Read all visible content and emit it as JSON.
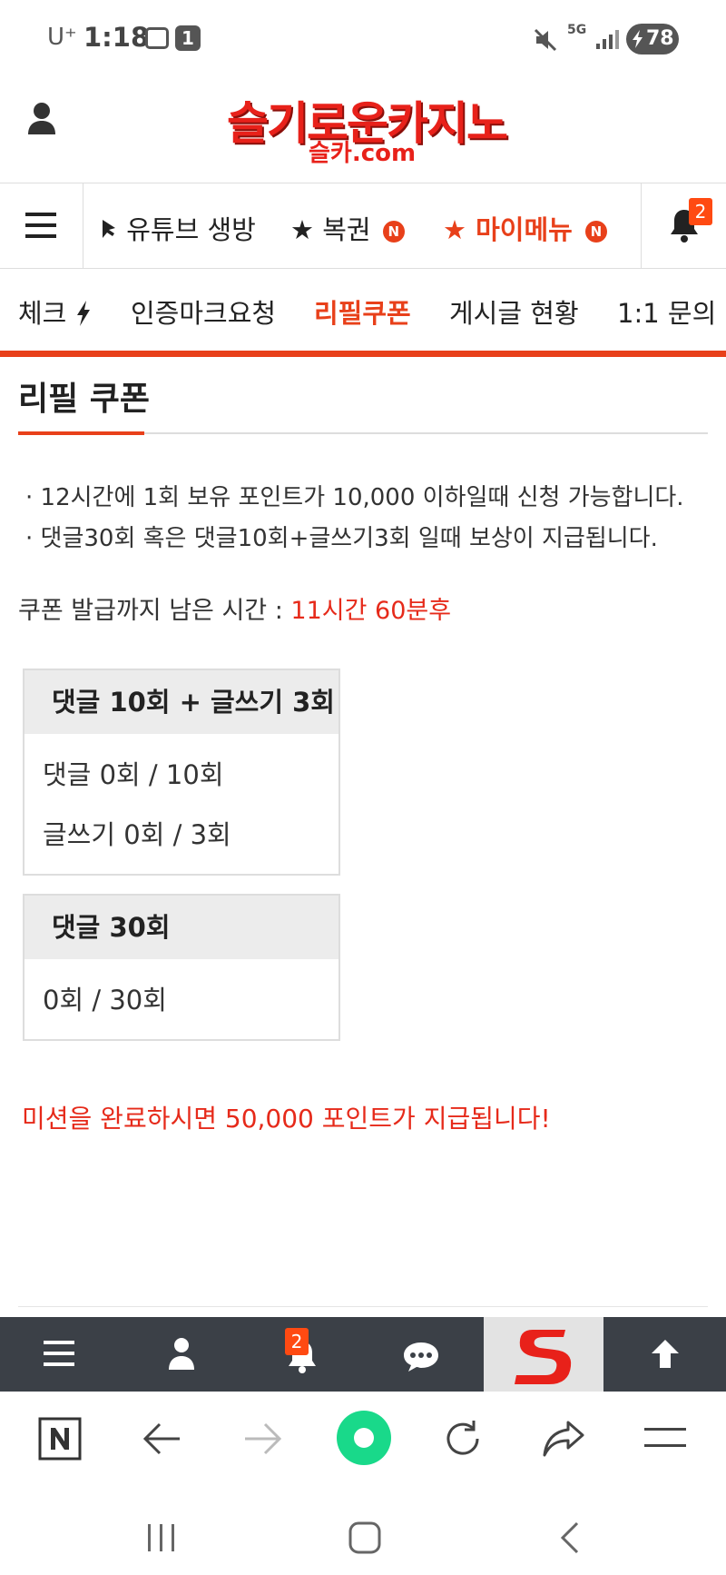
{
  "status": {
    "carrier": "U⁺",
    "time": "1:18",
    "notif_count": "1",
    "network": "5G",
    "battery": "78"
  },
  "header": {
    "logo_main": "슬기로운카지노",
    "logo_sub": "슬카.com"
  },
  "nav": {
    "items": [
      {
        "label": "유튜브 생방"
      },
      {
        "label": "복권",
        "badge": "N"
      },
      {
        "label": "마이메뉴",
        "badge": "N"
      }
    ],
    "bell_count": "2"
  },
  "subnav": {
    "items": [
      "체크",
      "인증마크요청",
      "리필쿠폰",
      "게시글 현황",
      "1:1 문의"
    ]
  },
  "page": {
    "title": "리필 쿠폰",
    "bullets": [
      "· 12시간에 1회 보유 포인트가 10,000 이하일때 신청 가능합니다.",
      "· 댓글30회 혹은 댓글10회+글쓰기3회 일때 보상이 지급됩니다."
    ],
    "remain_label": "쿠폰 발급까지 남은 시간 : ",
    "remain_value": "11시간 60분후",
    "box1": {
      "title": "댓글 10회 + 글쓰기 3회",
      "row1": "댓글 0회 / 10회",
      "row2": "글쓰기 0회 / 3회"
    },
    "box2": {
      "title": "댓글 30회",
      "row1": "0회 / 30회"
    },
    "mission": "미션을 완료하시면 50,000 포인트가 지급됩니다!"
  },
  "sitebar": {
    "bell_count": "2",
    "logo_letter": "S"
  },
  "colors": {
    "accent": "#e8401a",
    "red_text": "#e62a1a",
    "sitebar_bg": "#3b4047",
    "browser_green": "#19d98a"
  }
}
